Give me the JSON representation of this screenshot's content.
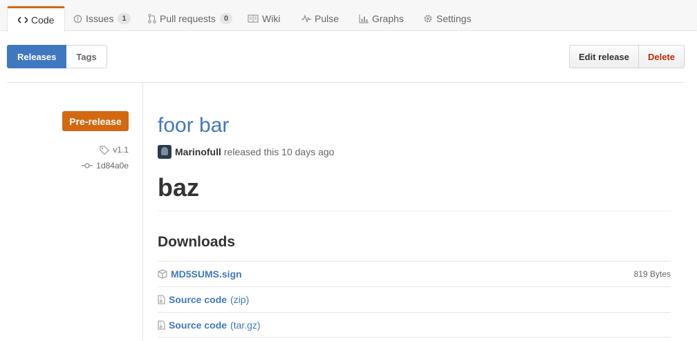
{
  "tabs": [
    {
      "label": "Code",
      "icon": "code-icon"
    },
    {
      "label": "Issues",
      "icon": "issue-icon",
      "count": "1"
    },
    {
      "label": "Pull requests",
      "icon": "pull-request-icon",
      "count": "0"
    },
    {
      "label": "Wiki",
      "icon": "book-icon"
    },
    {
      "label": "Pulse",
      "icon": "pulse-icon"
    },
    {
      "label": "Graphs",
      "icon": "graph-icon"
    },
    {
      "label": "Settings",
      "icon": "gear-icon"
    }
  ],
  "subnav": {
    "releases_label": "Releases",
    "tags_label": "Tags"
  },
  "actions": {
    "edit_label": "Edit release",
    "delete_label": "Delete"
  },
  "release": {
    "badge": "Pre-release",
    "tag": "v1.1",
    "commit": "1d84a0e",
    "title": "foor bar",
    "author": "Marinofull",
    "released_text": "released this 10 days ago",
    "body_heading": "baz"
  },
  "downloads": {
    "heading": "Downloads",
    "items": [
      {
        "name": "MD5SUMS.sign",
        "ext": "",
        "size": "819 Bytes",
        "icon": "package-icon"
      },
      {
        "name": "Source code",
        "ext": "(zip)",
        "size": "",
        "icon": "file-zip-icon"
      },
      {
        "name": "Source code",
        "ext": "(tar.gz)",
        "size": "",
        "icon": "file-zip-icon"
      }
    ]
  },
  "colors": {
    "accent": "#4078c0",
    "prerelease": "#d26911",
    "danger": "#bd2c00",
    "tab_highlight": "#d26911"
  }
}
